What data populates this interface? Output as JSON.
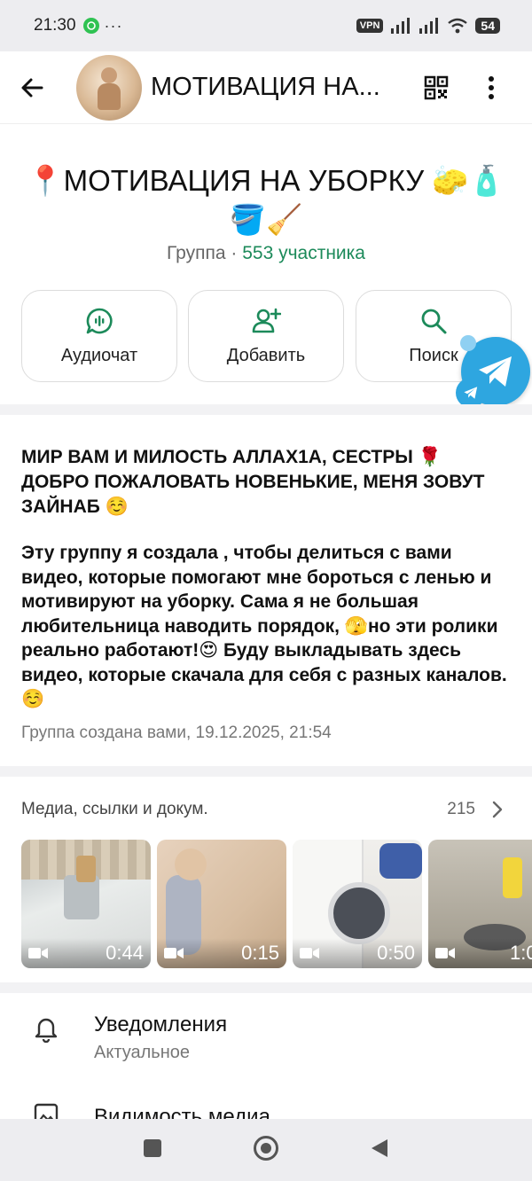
{
  "status_bar": {
    "time": "21:30",
    "dots": "···",
    "vpn": "VPN",
    "battery": "54"
  },
  "app_bar": {
    "title": "МОТИВАЦИЯ НА..."
  },
  "group": {
    "name": "📍МОТИВАЦИЯ НА УБОРКУ 🧽🧴🪣🧹",
    "type": "Группа",
    "separator": " · ",
    "members": "553 участника"
  },
  "actions": [
    {
      "label": "Аудиочат"
    },
    {
      "label": "Добавить"
    },
    {
      "label": "Поиск"
    }
  ],
  "description": {
    "title": "МИР ВАМ И МИЛОСТЬ АЛЛАХ1А, СЕСТРЫ 🌹 ДОБРО ПОЖАЛОВАТЬ НОВЕНЬКИЕ, МЕНЯ ЗОВУТ ЗАЙНАБ ☺️",
    "body": "Эту группу я создала , чтобы делиться с вами видео, которые помогают мне бороться с ленью и мотивируют на уборку. Сама я не большая любительница наводить порядок, 🫣но эти ролики реально работают!😍 Буду выкладывать здесь видео, которые скачала для себя с разных каналов.☺️",
    "meta": "Группа создана вами, 19.12.2025, 21:54"
  },
  "media": {
    "header": "Медиа, ссылки и докум.",
    "count": "215",
    "items": [
      {
        "duration": "0:44"
      },
      {
        "duration": "0:15"
      },
      {
        "duration": "0:50"
      },
      {
        "duration": "1:0"
      }
    ]
  },
  "settings": {
    "notifications_title": "Уведомления",
    "notifications_value": "Актуальное",
    "visibility_title": "Видимость медиа"
  },
  "colors": {
    "accent": "#1c8a5a",
    "telegram": "#2ea6e0"
  }
}
